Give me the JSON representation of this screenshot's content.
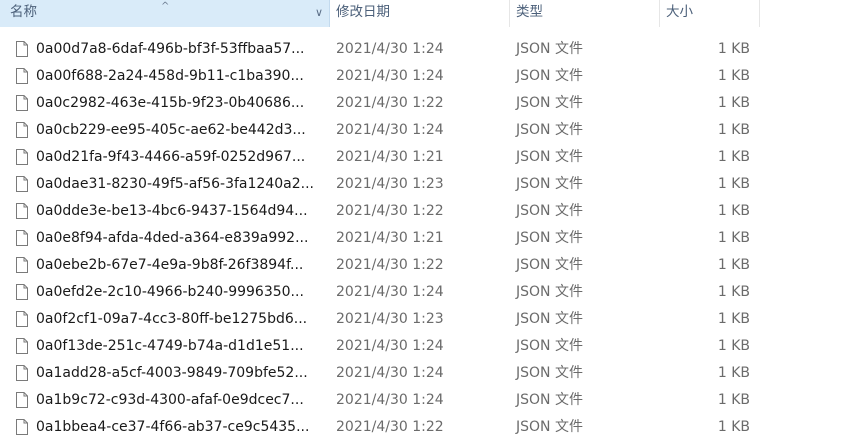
{
  "headers": {
    "name": "名称",
    "date": "修改日期",
    "type": "类型",
    "size": "大小",
    "sort_caret": "^",
    "chevron": "∨"
  },
  "files": [
    {
      "name": "0a00d7a8-6daf-496b-bf3f-53ffbaa57...",
      "date": "2021/4/30 1:24",
      "type": "JSON 文件",
      "size": "1 KB"
    },
    {
      "name": "0a00f688-2a24-458d-9b11-c1ba390...",
      "date": "2021/4/30 1:24",
      "type": "JSON 文件",
      "size": "1 KB"
    },
    {
      "name": "0a0c2982-463e-415b-9f23-0b40686...",
      "date": "2021/4/30 1:22",
      "type": "JSON 文件",
      "size": "1 KB"
    },
    {
      "name": "0a0cb229-ee95-405c-ae62-be442d3...",
      "date": "2021/4/30 1:24",
      "type": "JSON 文件",
      "size": "1 KB"
    },
    {
      "name": "0a0d21fa-9f43-4466-a59f-0252d967...",
      "date": "2021/4/30 1:21",
      "type": "JSON 文件",
      "size": "1 KB"
    },
    {
      "name": "0a0dae31-8230-49f5-af56-3fa1240a2...",
      "date": "2021/4/30 1:23",
      "type": "JSON 文件",
      "size": "1 KB"
    },
    {
      "name": "0a0dde3e-be13-4bc6-9437-1564d94...",
      "date": "2021/4/30 1:22",
      "type": "JSON 文件",
      "size": "1 KB"
    },
    {
      "name": "0a0e8f94-afda-4ded-a364-e839a992...",
      "date": "2021/4/30 1:21",
      "type": "JSON 文件",
      "size": "1 KB"
    },
    {
      "name": "0a0ebe2b-67e7-4e9a-9b8f-26f3894f...",
      "date": "2021/4/30 1:22",
      "type": "JSON 文件",
      "size": "1 KB"
    },
    {
      "name": "0a0efd2e-2c10-4966-b240-9996350...",
      "date": "2021/4/30 1:24",
      "type": "JSON 文件",
      "size": "1 KB"
    },
    {
      "name": "0a0f2cf1-09a7-4cc3-80ff-be1275bd6...",
      "date": "2021/4/30 1:23",
      "type": "JSON 文件",
      "size": "1 KB"
    },
    {
      "name": "0a0f13de-251c-4749-b74a-d1d1e51...",
      "date": "2021/4/30 1:24",
      "type": "JSON 文件",
      "size": "1 KB"
    },
    {
      "name": "0a1add28-a5cf-4003-9849-709bfe52...",
      "date": "2021/4/30 1:24",
      "type": "JSON 文件",
      "size": "1 KB"
    },
    {
      "name": "0a1b9c72-c93d-4300-afaf-0e9dcec7...",
      "date": "2021/4/30 1:24",
      "type": "JSON 文件",
      "size": "1 KB"
    },
    {
      "name": "0a1bbea4-ce37-4f66-ab37-ce9c5435...",
      "date": "2021/4/30 1:22",
      "type": "JSON 文件",
      "size": "1 KB"
    }
  ]
}
